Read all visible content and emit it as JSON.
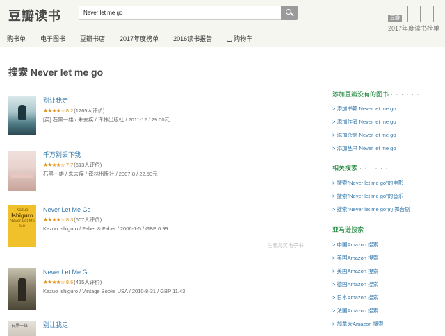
{
  "header": {
    "logo": "豆瓣读书",
    "search_value": "Never let me go",
    "nav": [
      "购书单",
      "电子图书",
      "豆瓣书店",
      "2017年度榜单",
      "2016读书报告",
      "购物车"
    ],
    "badge_tag": "豆瓣",
    "badge_text": "2017年度读书榜单"
  },
  "page_title": "搜索 Never let me go",
  "results": [
    {
      "title": "别让我走",
      "stars": "★★★★☆",
      "score": "8.2",
      "count": "(1265人评价)",
      "pub": "[英] 石黑一雄 / 朱去疾 / 译林出版社 / 2011-12 / 29.00元"
    },
    {
      "title": "千万别丢下我",
      "stars": "★★★★☆",
      "score": "7.7",
      "count": "(613人评价)",
      "pub": "石黑一雄 / 朱去疾 / 译林出版社 / 2007-8 / 22.50元"
    },
    {
      "title": "Never Let Me Go",
      "stars": "★★★★☆",
      "score": "8.3",
      "count": "(607人评价)",
      "pub": "Kazuo Ishiguro / Faber & Faber / 2006-1-5 / GBP 6.99",
      "cover_line1": "Kazuo",
      "cover_line2": "Ishiguro",
      "cover_line3": "Never Let Me Go"
    },
    {
      "title": "Never Let Me Go",
      "stars": "★★★★☆",
      "score": "8.6",
      "count": "(415人评价)",
      "pub": "Kazuo Ishiguro / Vintage Books USA / 2010-8-31 / GBP 11.43"
    },
    {
      "title": "别让我走",
      "cover_text": "石黑一雄"
    }
  ],
  "ebook_hint": "在哪儿买电子书",
  "sidebar": {
    "add_title": "添加豆瓣没有的图书",
    "add_links": [
      "> 添加书籍 Never let me go",
      "> 添加作者 Never let me go",
      "> 添加杂志 Never let me go",
      "> 添加丛书 Never let me go"
    ],
    "related_title": "相关搜索",
    "related_links": [
      "> 搜索\"Never let me go\"的电影",
      "> 搜索\"Never let me go\"的音乐",
      "> 搜索\"Never let me go\"的 舞台剧"
    ],
    "amazon_title": "亚马逊搜索",
    "amazon_links": [
      "> 中国Amazon 搜索",
      "> 美国Amazon 搜索",
      "> 英国Amazon 搜索",
      "> 德国Amazon 搜索",
      "> 日本Amazon 搜索",
      "> 法国Amazon 搜索",
      "> 加拿大Amazon 搜索"
    ]
  },
  "colors": {
    "link": "#3377aa",
    "section": "#007722",
    "star": "#e09015"
  }
}
